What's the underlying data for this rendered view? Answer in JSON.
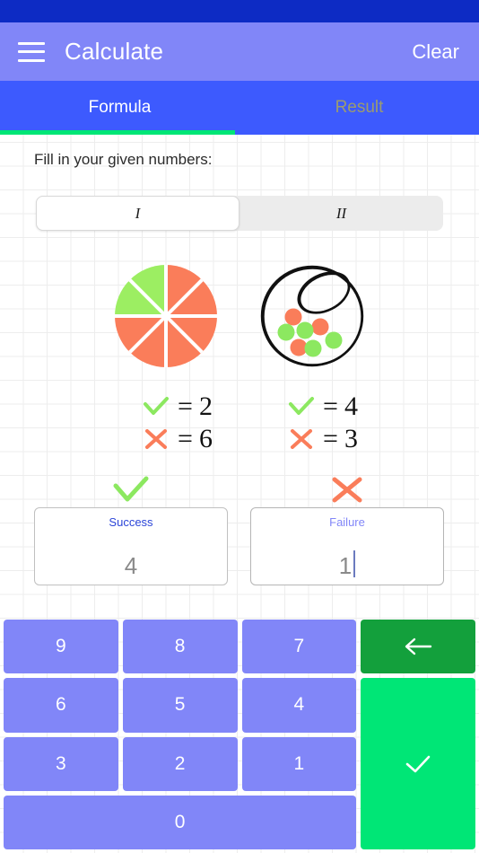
{
  "statusbar": {
    "color": "#0D2BC4"
  },
  "appbar": {
    "menu_icon": "hamburger-menu-icon",
    "title": "Calculate",
    "action_label": "Clear",
    "color": "#8186F8"
  },
  "tabs": {
    "color": "#3D5AFE",
    "indicator_color": "#00E676",
    "items": [
      {
        "label": "Formula",
        "active": true
      },
      {
        "label": "Result",
        "active": false
      }
    ]
  },
  "main": {
    "prompt": "Fill in your given numbers:",
    "segmented": {
      "options": [
        {
          "label": "I",
          "selected": true
        },
        {
          "label": "II",
          "selected": false
        }
      ]
    },
    "diagrams": [
      {
        "name": "pie-chart-diagram",
        "type": "pie",
        "slices": 8,
        "success_slices": 2,
        "failure_slices": 6,
        "success_color": "#9CEE62",
        "failure_color": "#FA7D5A"
      },
      {
        "name": "urn-balls-diagram",
        "type": "urn",
        "success_balls": 4,
        "failure_balls": 3,
        "success_color": "#8CE860",
        "failure_color": "#FA7D5A",
        "outline_color": "#111111"
      }
    ],
    "legends": [
      {
        "name": "legend-pie",
        "success": {
          "glyph": "check-icon",
          "equals": "=",
          "value": "2"
        },
        "failure": {
          "glyph": "cross-icon",
          "equals": "=",
          "value": "6"
        }
      },
      {
        "name": "legend-urn",
        "success": {
          "glyph": "check-icon",
          "equals": "=",
          "value": "4"
        },
        "failure": {
          "glyph": "cross-icon",
          "equals": "=",
          "value": "3"
        }
      }
    ],
    "fields": [
      {
        "name": "success-field",
        "icon": "check-icon",
        "label": "Success",
        "value": "4",
        "focused": false
      },
      {
        "name": "failure-field",
        "icon": "cross-icon",
        "label": "Failure",
        "value": "1",
        "focused": true
      }
    ]
  },
  "keypad": {
    "keys": [
      {
        "label": "9"
      },
      {
        "label": "8"
      },
      {
        "label": "7"
      },
      {
        "label": "6"
      },
      {
        "label": "5"
      },
      {
        "label": "4"
      },
      {
        "label": "3"
      },
      {
        "label": "2"
      },
      {
        "label": "1"
      },
      {
        "label": "0"
      }
    ],
    "backspace_icon": "arrow-left-icon",
    "confirm_icon": "check-icon",
    "digit_color": "#8186F8",
    "backspace_color": "#13A03C",
    "confirm_color": "#00E676"
  },
  "colors": {
    "success_green": "#8CE860",
    "failure_orange": "#FA7D5A",
    "accent_blue": "#2B45D8",
    "grid_line": "#ededed"
  }
}
